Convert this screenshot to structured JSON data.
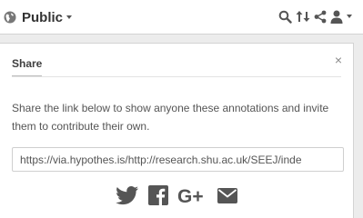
{
  "topbar": {
    "group_label": "Public",
    "icons": [
      "globe-icon",
      "search-icon",
      "sort-icon",
      "share-icon",
      "user-icon"
    ]
  },
  "share_panel": {
    "tab_label": "Share",
    "close_label": "×",
    "description": "Share the link below to show anyone these annotations and invite them to contribute their own.",
    "link_value": "https://via.hypothes.is/http://research.shu.ac.uk/SEEJ/inde",
    "share_targets": [
      "twitter-icon",
      "facebook-icon",
      "google-plus-icon",
      "email-icon"
    ]
  },
  "colors": {
    "icon_grey": "#555555",
    "background": "#ececec",
    "panel": "#ffffff"
  }
}
